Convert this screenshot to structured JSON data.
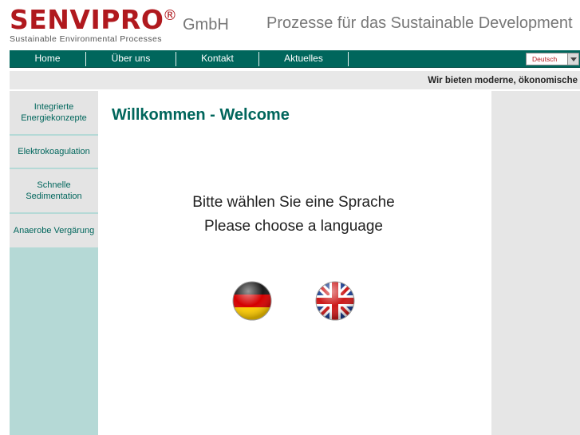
{
  "header": {
    "logo_main": "SENVIPRO",
    "logo_reg": "®",
    "logo_sub": "Sustainable Environmental Processes",
    "logo_gmbh": "GmbH",
    "tagline": "Prozesse für das Sustainable Development"
  },
  "nav": {
    "items": [
      "Home",
      "Über uns",
      "Kontakt",
      "Aktuelles"
    ],
    "language_selected": "Deutsch"
  },
  "ticker": {
    "text": "Wir bieten moderne, ökonomische"
  },
  "sidebar": {
    "items": [
      {
        "line1": "Integrierte",
        "line2": "Energiekonzepte"
      },
      {
        "line1": "Elektrokoagulation",
        "line2": ""
      },
      {
        "line1": "Schnelle",
        "line2": "Sedimentation"
      },
      {
        "line1": "Anaerobe Vergärung",
        "line2": ""
      }
    ]
  },
  "main": {
    "title": "Willkommen - Welcome",
    "choose_de": "Bitte wählen Sie eine Sprache",
    "choose_en": "Please choose a language"
  },
  "colors": {
    "brand_red": "#b0191e",
    "brand_green": "#00665c",
    "sidebar_bg": "#b5d9d6"
  },
  "icons": {
    "flag_de": "german-flag-icon",
    "flag_en": "uk-flag-icon"
  }
}
